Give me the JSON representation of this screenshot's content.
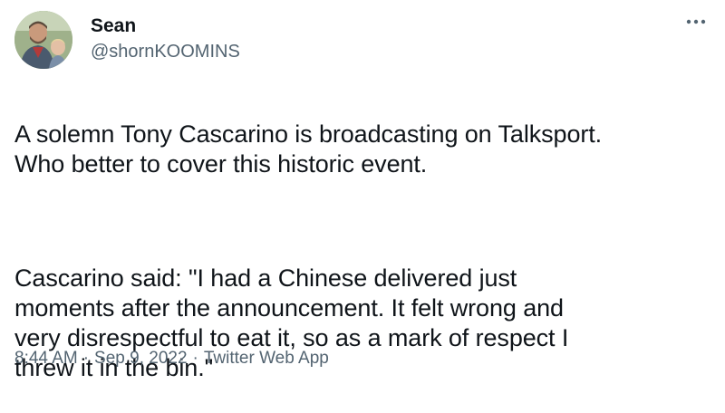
{
  "user": {
    "display_name": "Sean",
    "handle": "@shornKOOMINS"
  },
  "tweet": {
    "paragraphs": [
      "A solemn Tony Cascarino is broadcasting on Talksport.\nWho better to cover this historic event.",
      "Cascarino said: \"I had a Chinese delivered just\nmoments after the announcement. It felt wrong and\nvery disrespectful to eat it, so as a mark of respect I\nthrew it in the bin.\""
    ],
    "time": "8:44 AM",
    "date": "Sep 9, 2022",
    "source": "Twitter Web App",
    "separator": "·"
  },
  "icons": {
    "more": "more-options-icon",
    "avatar": "profile-avatar"
  },
  "colors": {
    "text": "#0f1419",
    "secondary": "#536471",
    "background": "#ffffff"
  }
}
